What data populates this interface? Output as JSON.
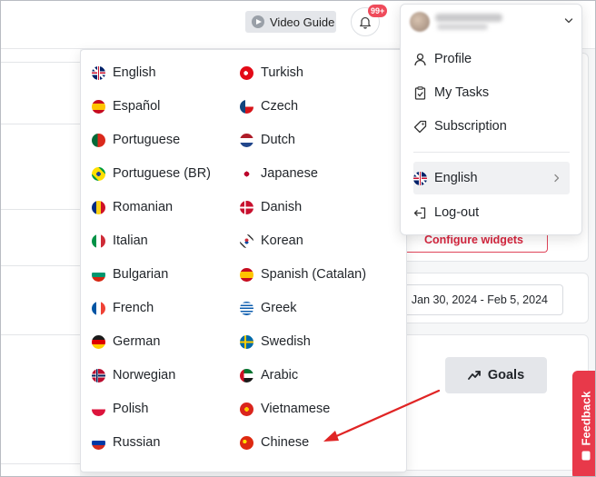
{
  "topbar": {
    "video_guide_label": "Video Guide",
    "notification_badge": "99+"
  },
  "language_menu": {
    "left_column": [
      {
        "label": "English",
        "flag": "uk"
      },
      {
        "label": "Español",
        "flag": "es"
      },
      {
        "label": "Portuguese",
        "flag": "pt"
      },
      {
        "label": "Portuguese (BR)",
        "flag": "br"
      },
      {
        "label": "Romanian",
        "flag": "ro"
      },
      {
        "label": "Italian",
        "flag": "it"
      },
      {
        "label": "Bulgarian",
        "flag": "bg"
      },
      {
        "label": "French",
        "flag": "fr"
      },
      {
        "label": "German",
        "flag": "de"
      },
      {
        "label": "Norwegian",
        "flag": "no"
      },
      {
        "label": "Polish",
        "flag": "pl"
      },
      {
        "label": "Russian",
        "flag": "ru"
      }
    ],
    "right_column": [
      {
        "label": "Turkish",
        "flag": "tr"
      },
      {
        "label": "Czech",
        "flag": "cz"
      },
      {
        "label": "Dutch",
        "flag": "nl"
      },
      {
        "label": "Japanese",
        "flag": "jp"
      },
      {
        "label": "Danish",
        "flag": "dk"
      },
      {
        "label": "Korean",
        "flag": "kr"
      },
      {
        "label": "Spanish (Catalan)",
        "flag": "es"
      },
      {
        "label": "Greek",
        "flag": "gr"
      },
      {
        "label": "Swedish",
        "flag": "se"
      },
      {
        "label": "Arabic",
        "flag": "ae"
      },
      {
        "label": "Vietnamese",
        "flag": "vn"
      },
      {
        "label": "Chinese",
        "flag": "cn"
      }
    ]
  },
  "profile_menu": {
    "items": [
      {
        "label": "Profile",
        "icon": "user-icon"
      },
      {
        "label": "My Tasks",
        "icon": "clipboard-check-icon"
      },
      {
        "label": "Subscription",
        "icon": "tag-icon"
      }
    ],
    "language": {
      "label": "English",
      "icon": "uk-flag-icon"
    },
    "logout": {
      "label": "Log-out",
      "icon": "logout-icon"
    }
  },
  "page": {
    "configure_widgets_label": "Configure widgets",
    "date_range": "Jan 30, 2024 - Feb 5, 2024",
    "goals_label": "Goals",
    "feedback_label": "Feedback"
  },
  "colors": {
    "accent_red": "#e8394a",
    "arrow": "#e02424",
    "badge": "#ef4b5b"
  }
}
